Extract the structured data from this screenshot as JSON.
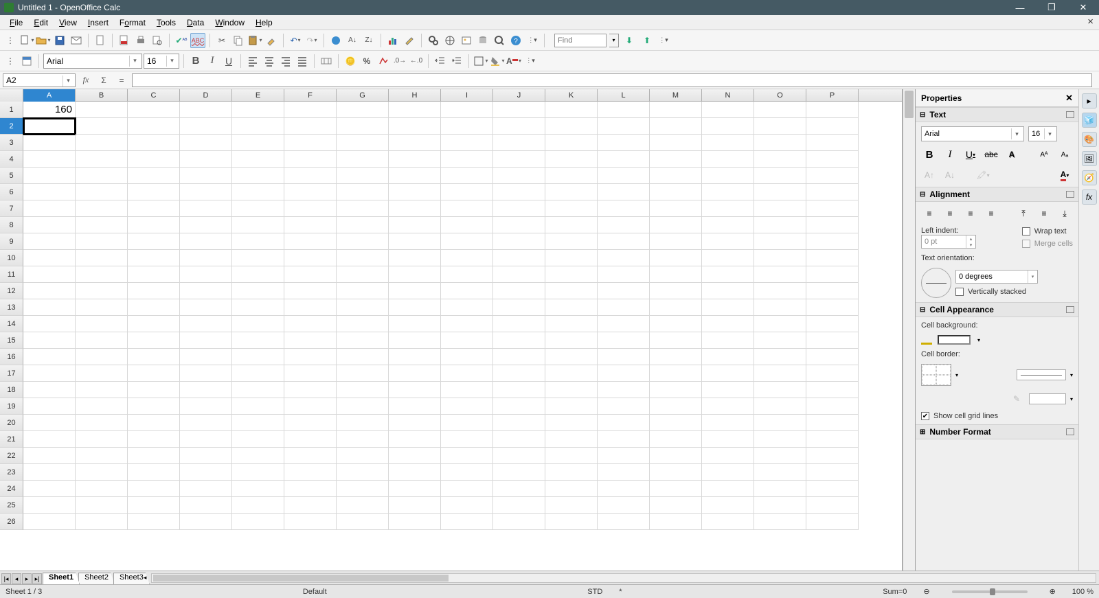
{
  "title": "Untitled 1 - OpenOffice Calc",
  "menu": [
    "File",
    "Edit",
    "View",
    "Insert",
    "Format",
    "Tools",
    "Data",
    "Window",
    "Help"
  ],
  "find_placeholder": "Find",
  "font_name": "Arial",
  "font_size": "16",
  "name_box": "A2",
  "formula_text": "",
  "columns": [
    "A",
    "B",
    "C",
    "D",
    "E",
    "F",
    "G",
    "H",
    "I",
    "J",
    "K",
    "L",
    "M",
    "N",
    "O",
    "P"
  ],
  "rows": [
    "1",
    "2",
    "3",
    "4",
    "5",
    "6",
    "7",
    "8",
    "9",
    "10",
    "11",
    "12",
    "13",
    "14",
    "15",
    "16",
    "17",
    "18",
    "19",
    "20",
    "21",
    "22",
    "23",
    "24",
    "25",
    "26"
  ],
  "active_col": "A",
  "active_row": "2",
  "cells": {
    "A1": "160"
  },
  "sheet_tabs": [
    "Sheet1",
    "Sheet2",
    "Sheet3"
  ],
  "active_sheet": "Sheet1",
  "sidebar": {
    "title": "Properties",
    "text_section": "Text",
    "align_section": "Alignment",
    "cellapp_section": "Cell Appearance",
    "numfmt_section": "Number Format",
    "font_name": "Arial",
    "font_size": "16",
    "left_indent_label": "Left indent:",
    "left_indent_value": "0 pt",
    "wrap_label": "Wrap text",
    "merge_label": "Merge cells",
    "orient_label": "Text orientation:",
    "orient_value": "0 degrees",
    "vstack_label": "Vertically stacked",
    "cellbg_label": "Cell background:",
    "cellbd_label": "Cell border:",
    "gridlines_label": "Show cell grid lines",
    "gridlines_checked": true
  },
  "status": {
    "sheet": "Sheet 1 / 3",
    "style": "Default",
    "mode": "STD",
    "marker": "*",
    "sum": "Sum=0",
    "zoom": "100 %"
  }
}
